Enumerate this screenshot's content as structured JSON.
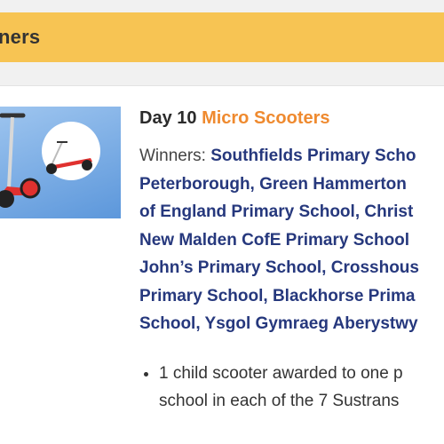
{
  "banner": {
    "title": "ners"
  },
  "prize": {
    "image_alt": "Micro Scooters thumbnail",
    "day_label": "Day 10",
    "brand": "Micro Scooters",
    "winners_label": "Winners:",
    "winner_lines": [
      "Southfields Primary Scho",
      "Peterborough, Green Hammerton",
      "of England Primary School, Christ",
      "New Malden CofE Primary School",
      "John’s Primary School, Crosshous",
      "Primary School, Blackhorse Prima",
      "School, Ysgol Gymraeg Aberystwy"
    ],
    "bullet_lines": [
      "1 child scooter awarded to one p",
      "school in each of the 7 Sustrans"
    ]
  },
  "colors": {
    "banner": "#f7c453",
    "brand_orange": "#ef8a2f",
    "school_blue": "#26387d"
  }
}
